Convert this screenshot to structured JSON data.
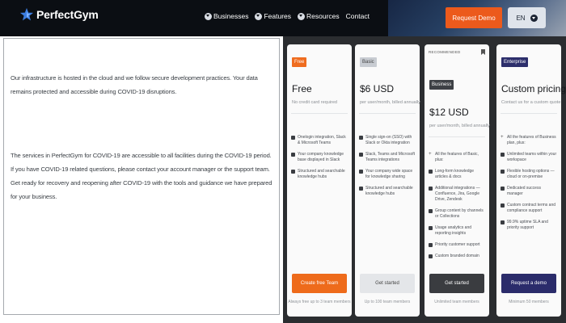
{
  "nav": {
    "brand": "PerfectGym",
    "links": [
      "Businesses",
      "Features",
      "Resources",
      "Contact"
    ],
    "cta_label": "Request Demo",
    "language": "EN"
  },
  "notice": {
    "paragraph1": "Our infrastructure is hosted in the cloud and we follow secure development practices. Your data remains protected and accessible during COVID-19 disruptions.",
    "paragraph2": "The services in PerfectGym for COVID-19 are accessible to all facilities during the COVID-19 period. If you have COVID-19 related questions, please contact your account manager or the support team. Get ready for recovery and reopening after COVID-19 with the tools and guidance we have prepared for your business."
  },
  "pricing": {
    "plans": [
      {
        "badge": "Free",
        "price": "Free",
        "sub": "No credit card required",
        "features": [
          {
            "type": "icon",
            "text": "Onelogin integration, Slack & Microsoft Teams"
          },
          {
            "type": "icon",
            "text": "Your company knowledge base displayed in Slack"
          },
          {
            "type": "icon",
            "text": "Structured and searchable knowledge hubs"
          }
        ],
        "button": "Create free Team",
        "footnote": "Always free up to 3 team members"
      },
      {
        "badge": "Basic",
        "price": "$6 USD",
        "sub": "per user/month, billed annually",
        "features": [
          {
            "type": "icon",
            "text": "Single sign-on (SSO) with Slack or Okta integration"
          },
          {
            "type": "icon",
            "text": "Slack, Teams and Microsoft Teams integrations"
          },
          {
            "type": "icon",
            "text": "Your company wide space for knowledge sharing"
          },
          {
            "type": "icon",
            "text": "Structured and searchable knowledge hubs"
          }
        ],
        "button": "Get started",
        "footnote": "Up to 100 team members"
      },
      {
        "recommended": "RECOMMENDED",
        "badge": "Business",
        "price": "$12 USD",
        "sub": "per user/month, billed annually",
        "features": [
          {
            "type": "plus",
            "text": "All the features of Basic, plus:"
          },
          {
            "type": "icon",
            "text": "Long-form knowledge articles & docs"
          },
          {
            "type": "icon",
            "text": "Additional integrations — Confluence, Jira, Google Drive, Zendesk"
          },
          {
            "type": "icon",
            "text": "Group content by channels or Collections"
          },
          {
            "type": "icon",
            "text": "Usage analytics and reporting insights"
          },
          {
            "type": "icon",
            "text": "Priority customer support"
          },
          {
            "type": "icon",
            "text": "Custom branded domain"
          }
        ],
        "button": "Get started",
        "footnote": "Unlimited team members"
      },
      {
        "badge": "Enterprise",
        "price": "Custom pricing",
        "sub": "Contact us for a custom quote",
        "features": [
          {
            "type": "plus",
            "text": "All the features of Business plan, plus:"
          },
          {
            "type": "icon",
            "text": "Unlimited teams within your workspace"
          },
          {
            "type": "icon",
            "text": "Flexible hosting options — cloud or on-premise"
          },
          {
            "type": "icon",
            "text": "Dedicated success manager"
          },
          {
            "type": "icon",
            "text": "Custom contract terms and compliance support"
          },
          {
            "type": "icon",
            "text": "99.9% uptime SLA and priority support"
          }
        ],
        "button": "Request a demo",
        "footnote": "Minimum 50 members"
      }
    ]
  },
  "colors": {
    "nav_bg": "#0b0e13",
    "accent": "#ec5a1c",
    "enterprise": "#2b2c6b",
    "pricing_bg": "#2b2d30"
  }
}
